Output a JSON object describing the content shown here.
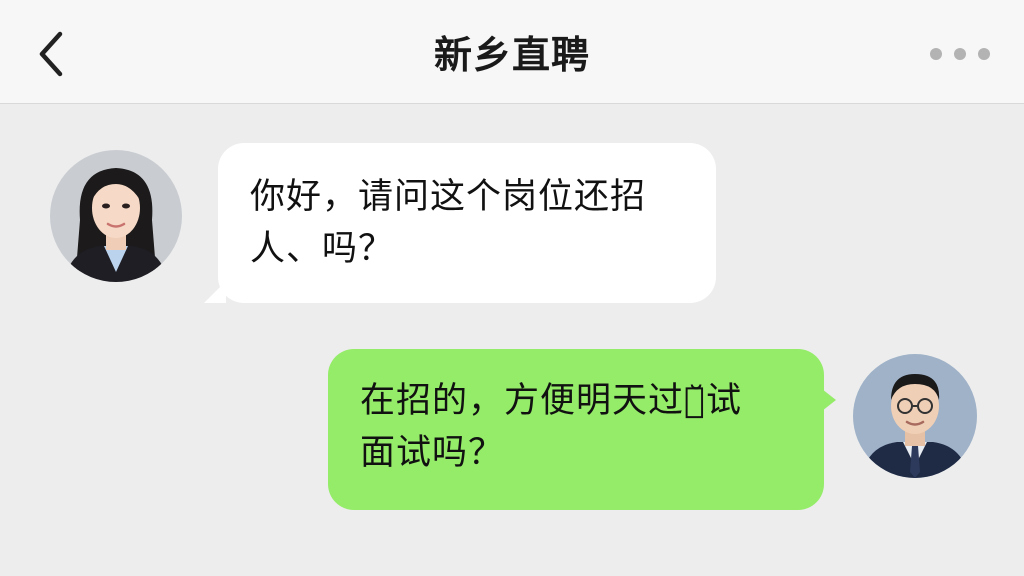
{
  "header": {
    "title": "新乡直聘",
    "back_icon": "chevron-left-icon",
    "more_icon": "more-dots-icon"
  },
  "messages": [
    {
      "side": "left",
      "sender": "candidate",
      "line1": "你好，请问这个岗位还招",
      "line2": "人、吗？",
      "bubble_color": "#ffffff"
    },
    {
      "side": "right",
      "sender": "recruiter",
      "line1": "在招的，方便明天过来̆试",
      "line2": "面试吗？",
      "bubble_color": "#95ec69"
    }
  ],
  "colors": {
    "background": "#ededed",
    "header": "#f7f7f7",
    "sent_bubble": "#95ec69",
    "received_bubble": "#ffffff"
  }
}
